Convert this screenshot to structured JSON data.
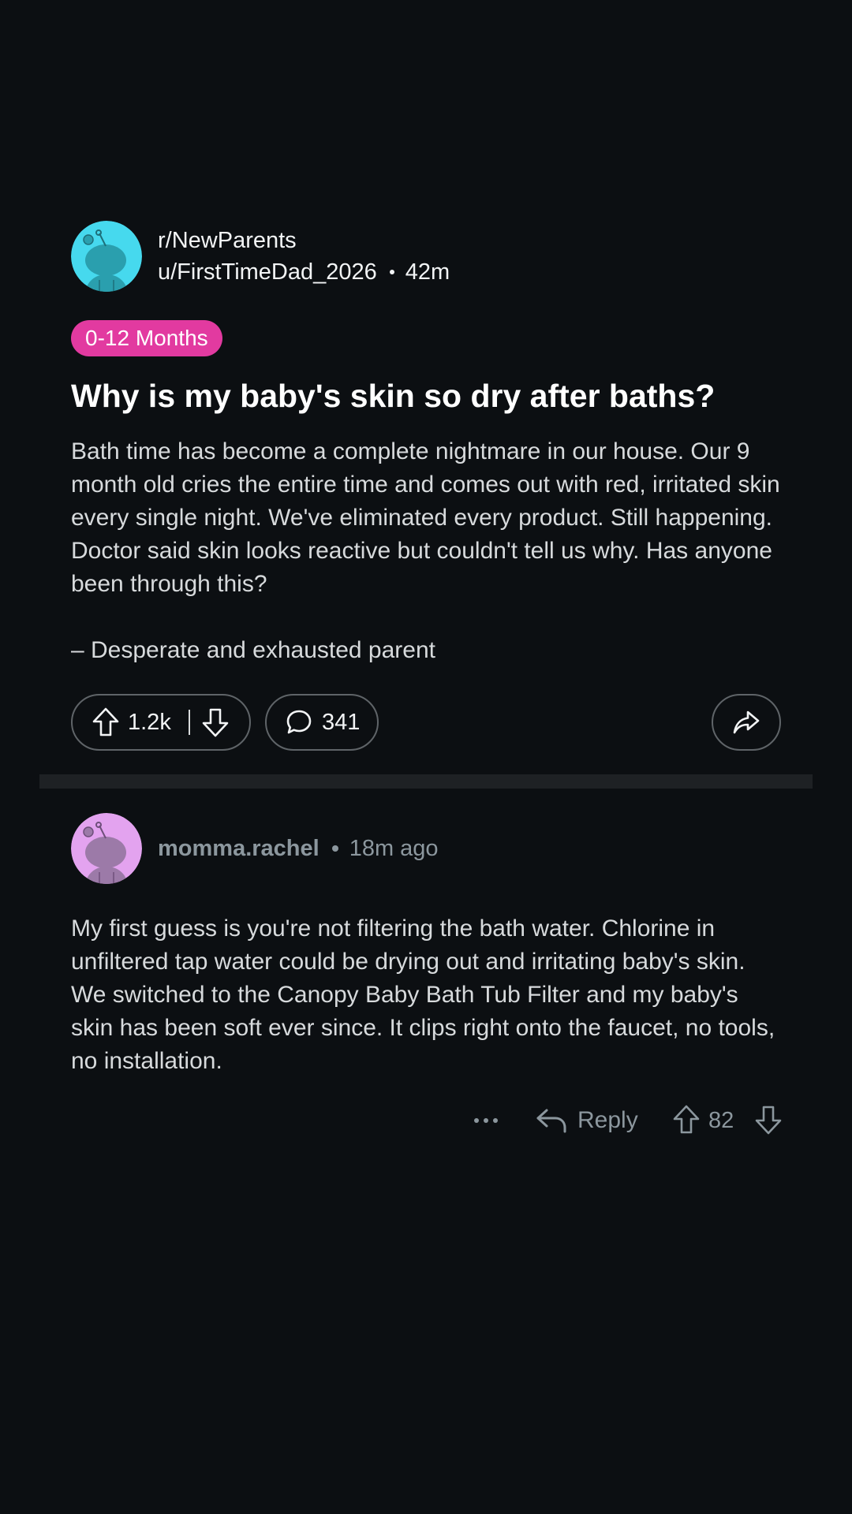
{
  "post": {
    "subreddit": "r/NewParents",
    "author": "u/FirstTimeDad_2026",
    "age": "42m",
    "flair": "0-12 Months",
    "flair_color": "#e23aa0",
    "title": "Why is my baby's skin so dry after baths?",
    "body": "Bath time has become a complete nightmare in our house. Our 9 month old cries the entire time and comes out with red, irritated skin every single night. We've eliminated every product. Still happening. Doctor said skin looks reactive but couldn't tell us why. Has anyone been through this?",
    "signature": "– Desperate and exhausted parent",
    "avatar_color": "#46d9ee",
    "avatar_icon": "snoo-avatar-icon"
  },
  "actions": {
    "upvotes": "1.2k",
    "comments": "341",
    "upvote_icon": "arrow-up-icon",
    "downvote_icon": "arrow-down-icon",
    "comment_icon": "speech-bubble-icon",
    "share_icon": "share-arrow-icon"
  },
  "comment": {
    "author": "momma.rachel",
    "time": "18m ago",
    "body": "My first guess is you're not filtering the bath water. Chlorine in unfiltered tap water could be drying out and irritating baby's skin. We switched to the Canopy Baby Bath Tub Filter and my baby's skin has been soft ever since. It clips right onto the faucet, no tools, no installation.",
    "reply_label": "Reply",
    "votes": "82",
    "avatar_color": "#e3a3ef",
    "more_icon": "ellipsis-icon",
    "reply_icon": "reply-arrow-icon"
  }
}
